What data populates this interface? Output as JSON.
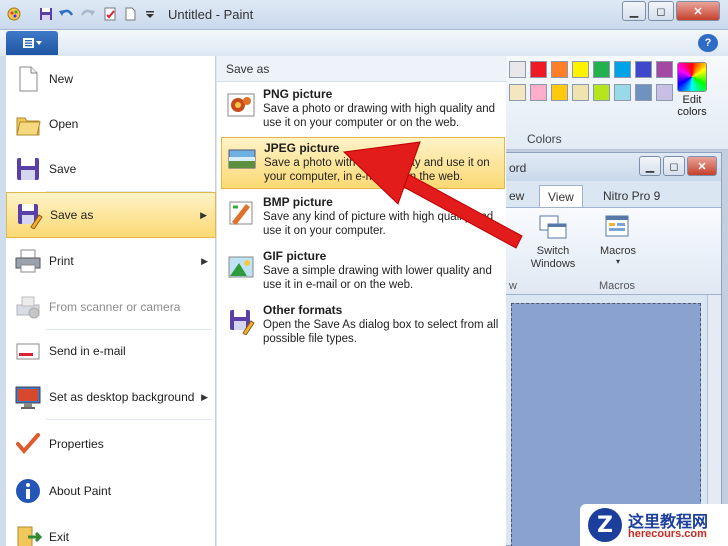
{
  "window": {
    "title": "Untitled - Paint",
    "minimize": "▁",
    "maximize": "◻",
    "close": "✕"
  },
  "ribbon": {
    "file_tab_icon": "menu-icon",
    "help": "?"
  },
  "colors": {
    "label": "Colors",
    "edit_colors": "Edit colors",
    "row1": [
      "#e8e8e8",
      "#ed1c24",
      "#ff7f27",
      "#fff200",
      "#22b14c",
      "#00a2e8",
      "#3f48cc",
      "#a349a4"
    ],
    "row2": [
      "#f4e7c0",
      "#ffaec9",
      "#ffc90e",
      "#efe4b0",
      "#b5e61d",
      "#99d9ea",
      "#7092be",
      "#c8bfe7"
    ]
  },
  "word_window": {
    "title": "ord",
    "tabs": [
      "ew",
      "View",
      "Nitro Pro 9"
    ],
    "switch_windows": "Switch Windows",
    "macros": "Macros",
    "macros_group": "Macros",
    "w_label": "w"
  },
  "file_menu": {
    "items": [
      {
        "label": "New",
        "icon": "new-document-icon",
        "arrow": false,
        "disabled": false
      },
      {
        "label": "Open",
        "icon": "folder-icon",
        "arrow": false,
        "disabled": false
      },
      {
        "label": "Save",
        "icon": "floppy-disk-icon",
        "arrow": false,
        "disabled": false
      },
      {
        "label": "Save as",
        "icon": "save-as-icon",
        "arrow": true,
        "disabled": false
      },
      {
        "label": "Print",
        "icon": "printer-icon",
        "arrow": true,
        "disabled": false
      },
      {
        "label": "From scanner or camera",
        "icon": "scanner-icon",
        "arrow": false,
        "disabled": true
      },
      {
        "label": "Send in e-mail",
        "icon": "email-icon",
        "arrow": false,
        "disabled": false
      },
      {
        "label": "Set as desktop background",
        "icon": "desktop-icon",
        "arrow": true,
        "disabled": false
      },
      {
        "label": "Properties",
        "icon": "checkmark-icon",
        "arrow": false,
        "disabled": false
      },
      {
        "label": "About Paint",
        "icon": "info-icon",
        "arrow": false,
        "disabled": false
      },
      {
        "label": "Exit",
        "icon": "exit-icon",
        "arrow": false,
        "disabled": false
      }
    ]
  },
  "save_as_menu": {
    "header": "Save as",
    "items": [
      {
        "title": "PNG picture",
        "desc": "Save a photo or drawing with high quality and use it on your computer or on the web.",
        "icon": "png-picture-icon"
      },
      {
        "title": "JPEG picture",
        "desc": "Save a photo with good quality and use it on your computer, in e-mail or on the web.",
        "icon": "jpeg-picture-icon"
      },
      {
        "title": "BMP picture",
        "desc": "Save any kind of picture with high quality and use it on your computer.",
        "icon": "bmp-picture-icon"
      },
      {
        "title": "GIF picture",
        "desc": "Save a simple drawing with lower quality and use it in e-mail or on the web.",
        "icon": "gif-picture-icon"
      },
      {
        "title": "Other formats",
        "desc": "Open the Save As dialog box to select from all possible file types.",
        "icon": "other-formats-icon"
      }
    ]
  },
  "watermark": {
    "text": "这里教程网",
    "url": "herecours.com",
    "logo": "Z"
  },
  "accent": {
    "highlight": "#fbd974",
    "arrow_red": "#e21b1b",
    "file_tab": "#2a62b0"
  }
}
